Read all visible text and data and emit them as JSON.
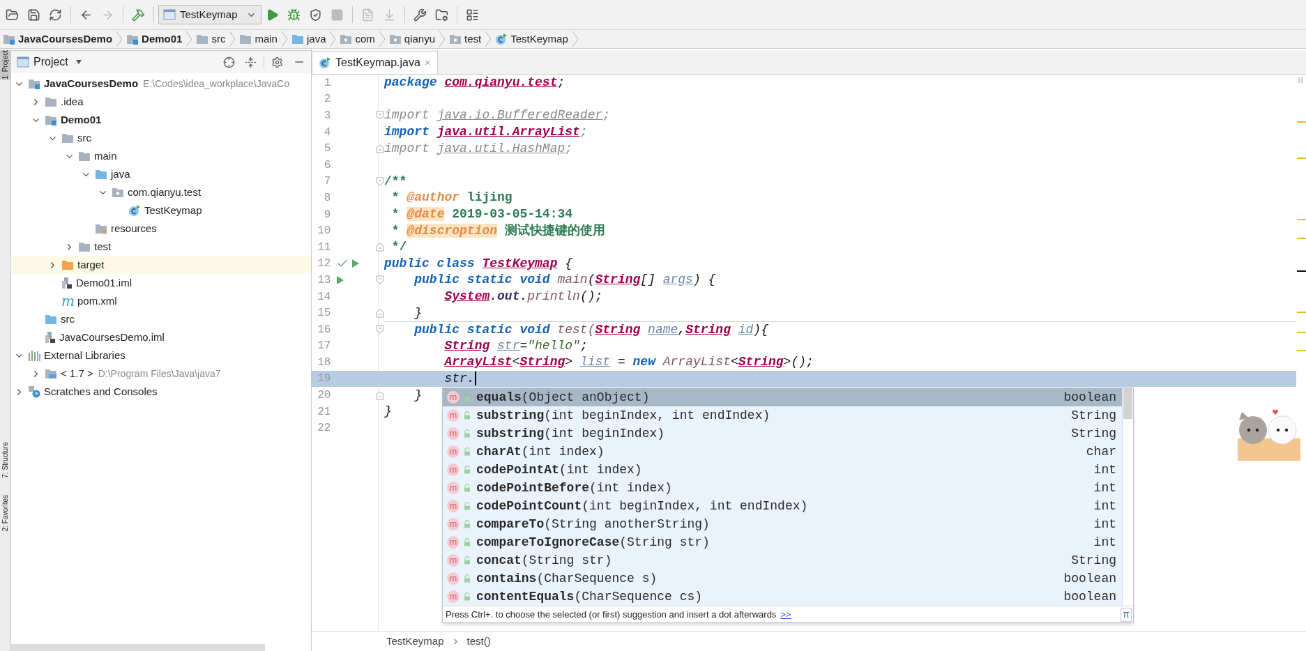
{
  "toolbar": {
    "buttons": [
      {
        "kind": "open",
        "disabled": false
      },
      {
        "kind": "save",
        "disabled": false
      },
      {
        "kind": "sync",
        "disabled": false
      },
      {
        "kind": "back",
        "disabled": false
      },
      {
        "kind": "forward",
        "disabled": true
      },
      {
        "kind": "build",
        "disabled": false
      },
      {
        "kind": "run_config",
        "label": "TestKeymap",
        "disabled": false
      },
      {
        "kind": "run",
        "disabled": false
      },
      {
        "kind": "debug",
        "disabled": false
      },
      {
        "kind": "coverage",
        "disabled": false
      },
      {
        "kind": "stop",
        "disabled": true
      },
      {
        "kind": "vcs_update",
        "disabled": true
      },
      {
        "kind": "vcs_commit",
        "disabled": true
      },
      {
        "kind": "settings",
        "disabled": false
      },
      {
        "kind": "project_structure",
        "disabled": false
      },
      {
        "kind": "layout",
        "disabled": false
      }
    ]
  },
  "breadcrumb": [
    {
      "label": "JavaCoursesDemo",
      "kind": "module",
      "bold": true
    },
    {
      "label": "Demo01",
      "kind": "module",
      "bold": true
    },
    {
      "label": "src",
      "kind": "folder",
      "bold": false
    },
    {
      "label": "main",
      "kind": "folder",
      "bold": false
    },
    {
      "label": "java",
      "kind": "source",
      "bold": false
    },
    {
      "label": "com",
      "kind": "package",
      "bold": false
    },
    {
      "label": "qianyu",
      "kind": "package",
      "bold": false
    },
    {
      "label": "test",
      "kind": "package",
      "bold": false
    },
    {
      "label": "TestKeymap",
      "kind": "class",
      "bold": false
    }
  ],
  "side_tabs": [
    {
      "label": "1: Project",
      "selected": true
    },
    {
      "label": "7: Structure",
      "selected": false
    },
    {
      "label": "2: Favorites",
      "selected": false
    }
  ],
  "project": {
    "title": "Project",
    "tree": [
      {
        "label": "JavaCoursesDemo",
        "kind": "module",
        "bold": true,
        "path": "E:\\Codes\\idea_workplace\\JavaCo",
        "expanded": true,
        "highlighted": false,
        "children": [
          {
            "label": ".idea",
            "kind": "folder",
            "bold": false,
            "expanded": false,
            "highlighted": false
          },
          {
            "label": "Demo01",
            "kind": "module",
            "bold": true,
            "expanded": true,
            "highlighted": false,
            "children": [
              {
                "label": "src",
                "kind": "folder",
                "bold": false,
                "expanded": true,
                "highlighted": false,
                "children": [
                  {
                    "label": "main",
                    "kind": "folder",
                    "bold": false,
                    "expanded": true,
                    "highlighted": false,
                    "children": [
                      {
                        "label": "java",
                        "kind": "source",
                        "bold": false,
                        "expanded": true,
                        "highlighted": false,
                        "children": [
                          {
                            "label": "com.qianyu.test",
                            "kind": "package",
                            "bold": false,
                            "expanded": true,
                            "highlighted": false,
                            "children": [
                              {
                                "label": "TestKeymap",
                                "kind": "class",
                                "bold": false,
                                "highlighted": false
                              }
                            ]
                          }
                        ]
                      },
                      {
                        "label": "resources",
                        "kind": "resources",
                        "bold": false,
                        "highlighted": false
                      }
                    ]
                  },
                  {
                    "label": "test",
                    "kind": "folder",
                    "bold": false,
                    "expanded": false,
                    "highlighted": false
                  }
                ]
              },
              {
                "label": "target",
                "kind": "excluded",
                "bold": false,
                "expanded": false,
                "highlighted": true
              },
              {
                "label": "Demo01.iml",
                "kind": "iml",
                "bold": false,
                "highlighted": false
              },
              {
                "label": "pom.xml",
                "kind": "maven",
                "glyph": "m",
                "bold": false,
                "highlighted": false
              }
            ]
          },
          {
            "label": "src",
            "kind": "source",
            "bold": false,
            "highlighted": false
          },
          {
            "label": "JavaCoursesDemo.iml",
            "kind": "iml",
            "bold": false,
            "highlighted": false
          }
        ]
      },
      {
        "label": "External Libraries",
        "kind": "libraries",
        "bold": false,
        "expanded": true,
        "highlighted": false,
        "children": [
          {
            "label": "< 1.7 >",
            "kind": "jdk",
            "bold": false,
            "path": "D:\\Program Files\\Java\\java7",
            "expanded": false,
            "highlighted": false
          }
        ]
      },
      {
        "label": "Scratches and Consoles",
        "kind": "scratches",
        "bold": false,
        "expanded": false,
        "highlighted": false
      }
    ]
  },
  "editor": {
    "tabs": [
      {
        "label": "TestKeymap.java",
        "kind": "class",
        "selected": true,
        "close": "×"
      }
    ],
    "lines": [
      {
        "number": "1",
        "current": false,
        "tokens": [
          {
            "text": "package ",
            "kind": "kw"
          },
          {
            "text": "com.qianyu.test",
            "kind": "type"
          },
          {
            "text": ";",
            "kind": "plain"
          }
        ]
      },
      {
        "number": "2",
        "current": false
      },
      {
        "number": "3",
        "current": false,
        "fold_marker": {
          "kind": "start"
        },
        "tokens": [
          {
            "text": "import ",
            "kind": "unused"
          },
          {
            "text": "java.io.BufferedReader",
            "kind": "unused_ref"
          },
          {
            "text": ";",
            "kind": "unused"
          }
        ]
      },
      {
        "number": "4",
        "current": false,
        "tokens": [
          {
            "text": "import ",
            "kind": "kw"
          },
          {
            "text": "java.util.ArrayList",
            "kind": "type"
          },
          {
            "text": ";",
            "kind": "unused"
          }
        ]
      },
      {
        "number": "5",
        "current": false,
        "fold_marker": {
          "kind": "end"
        },
        "tokens": [
          {
            "text": "import ",
            "kind": "unused"
          },
          {
            "text": "java.util.HashMap",
            "kind": "unused_ref"
          },
          {
            "text": ";",
            "kind": "unused"
          }
        ]
      },
      {
        "number": "6",
        "current": false
      },
      {
        "number": "7",
        "current": false,
        "fold_marker": {
          "kind": "start"
        },
        "tokens": [
          {
            "text": "/**",
            "kind": "comment"
          }
        ]
      },
      {
        "number": "8",
        "current": false,
        "tokens": [
          {
            "text": " * ",
            "kind": "comment"
          },
          {
            "text": "@author",
            "kind": "tag"
          },
          {
            "text": " lijing",
            "kind": "comment"
          }
        ]
      },
      {
        "number": "9",
        "current": false,
        "tokens": [
          {
            "text": " * ",
            "kind": "comment"
          },
          {
            "text": "@date",
            "kind": "tag_marked"
          },
          {
            "text": " 2019-03-05-14:34",
            "kind": "comment"
          }
        ]
      },
      {
        "number": "10",
        "current": false,
        "tokens": [
          {
            "text": " * ",
            "kind": "comment"
          },
          {
            "text": "@discroption",
            "kind": "tag_marked"
          },
          {
            "text": " 测试快捷键的使用",
            "kind": "comment"
          }
        ]
      },
      {
        "number": "11",
        "current": false,
        "fold_marker": {
          "kind": "end"
        },
        "tokens": [
          {
            "text": " */",
            "kind": "comment"
          }
        ]
      },
      {
        "number": "12",
        "current": false,
        "gutter": [
          {
            "kind": "check"
          },
          {
            "kind": "run"
          }
        ],
        "tokens": [
          {
            "text": "public class ",
            "kind": "kw"
          },
          {
            "text": "TestKeymap",
            "kind": "type"
          },
          {
            "text": " {",
            "kind": "plain"
          }
        ]
      },
      {
        "number": "13",
        "current": false,
        "gutter": [
          {
            "kind": "run"
          }
        ],
        "fold_marker": {
          "kind": "start"
        },
        "tokens": [
          {
            "text": "    public static void ",
            "kind": "kw"
          },
          {
            "text": "main",
            "kind": "method"
          },
          {
            "text": "(",
            "kind": "plain"
          },
          {
            "text": "String",
            "kind": "type"
          },
          {
            "text": "[] ",
            "kind": "plain"
          },
          {
            "text": "args",
            "kind": "param"
          },
          {
            "text": ") {",
            "kind": "plain"
          }
        ]
      },
      {
        "number": "14",
        "current": false,
        "tokens": [
          {
            "text": "        System",
            "kind": "type"
          },
          {
            "text": ".",
            "kind": "plain"
          },
          {
            "text": "out",
            "kind": "field"
          },
          {
            "text": ".",
            "kind": "plain"
          },
          {
            "text": "println",
            "kind": "method"
          },
          {
            "text": "();",
            "kind": "plain"
          }
        ]
      },
      {
        "number": "15",
        "current": false,
        "fold_marker": {
          "kind": "end"
        },
        "tokens": [
          {
            "text": "    }",
            "kind": "plain"
          }
        ]
      },
      {
        "number": "16",
        "current": false,
        "separator_above": true,
        "fold_marker": {
          "kind": "start"
        },
        "tokens": [
          {
            "text": "    public static void ",
            "kind": "kw"
          },
          {
            "text": "test(",
            "kind": "method"
          },
          {
            "text": "String",
            "kind": "type"
          },
          {
            "text": " name",
            "kind": "param"
          },
          {
            "text": ",",
            "kind": "plain"
          },
          {
            "text": "String",
            "kind": "type"
          },
          {
            "text": " id",
            "kind": "param"
          },
          {
            "text": "){",
            "kind": "plain"
          }
        ]
      },
      {
        "number": "17",
        "current": false,
        "tokens": [
          {
            "text": "        String",
            "kind": "type"
          },
          {
            "text": " str",
            "kind": "param"
          },
          {
            "text": "=",
            "kind": "plain"
          },
          {
            "text": "\"hello\"",
            "kind": "string"
          },
          {
            "text": ";",
            "kind": "plain"
          }
        ]
      },
      {
        "number": "18",
        "current": false,
        "tokens": [
          {
            "text": "        ArrayList",
            "kind": "type"
          },
          {
            "text": "<",
            "kind": "plain"
          },
          {
            "text": "String",
            "kind": "type"
          },
          {
            "text": ">",
            "kind": "plain"
          },
          {
            "text": " list",
            "kind": "param"
          },
          {
            "text": " = ",
            "kind": "plain"
          },
          {
            "text": "new ",
            "kind": "kw"
          },
          {
            "text": "ArrayList",
            "kind": "method"
          },
          {
            "text": "<",
            "kind": "plain"
          },
          {
            "text": "String",
            "kind": "type"
          },
          {
            "text": ">();",
            "kind": "plain"
          }
        ]
      },
      {
        "number": "19",
        "current": true,
        "tokens": [
          {
            "text": "        str.",
            "kind": "plain"
          }
        ]
      },
      {
        "number": "20",
        "current": false,
        "fold_marker": {
          "kind": "end"
        },
        "tokens": [
          {
            "text": "    }",
            "kind": "plain"
          }
        ]
      },
      {
        "number": "21",
        "current": false,
        "tokens": [
          {
            "text": "}",
            "kind": "plain"
          }
        ]
      },
      {
        "number": "22",
        "current": false
      }
    ],
    "completion": {
      "items": [
        {
          "glyph": "m",
          "signature": "**equals**(Object anObject)",
          "type": "boolean",
          "selected": true
        },
        {
          "glyph": "m",
          "signature": "**substring**(int beginIndex, int endIndex)",
          "type": "String",
          "selected": false
        },
        {
          "glyph": "m",
          "signature": "**substring**(int beginIndex)",
          "type": "String",
          "selected": false
        },
        {
          "glyph": "m",
          "signature": "**charAt**(int index)",
          "type": "char",
          "selected": false
        },
        {
          "glyph": "m",
          "signature": "**codePointAt**(int index)",
          "type": "int",
          "selected": false
        },
        {
          "glyph": "m",
          "signature": "**codePointBefore**(int index)",
          "type": "int",
          "selected": false
        },
        {
          "glyph": "m",
          "signature": "**codePointCount**(int beginIndex, int endIndex)",
          "type": "int",
          "selected": false
        },
        {
          "glyph": "m",
          "signature": "**compareTo**(String anotherString)",
          "type": "int",
          "selected": false
        },
        {
          "glyph": "m",
          "signature": "**compareToIgnoreCase**(String str)",
          "type": "int",
          "selected": false
        },
        {
          "glyph": "m",
          "signature": "**concat**(String str)",
          "type": "String",
          "selected": false
        },
        {
          "glyph": "m",
          "signature": "**contains**(CharSequence s)",
          "type": "boolean",
          "selected": false
        },
        {
          "glyph": "m",
          "signature": "**contentEquals**(CharSequence cs)",
          "type": "boolean",
          "selected": false
        }
      ],
      "hint": "Press Ctrl+. to choose the selected (or first) suggestion and insert a dot afterwards",
      "hint_link": ">>",
      "pi_button": "π"
    },
    "breadcrumb": [
      "TestKeymap",
      "test()"
    ]
  }
}
